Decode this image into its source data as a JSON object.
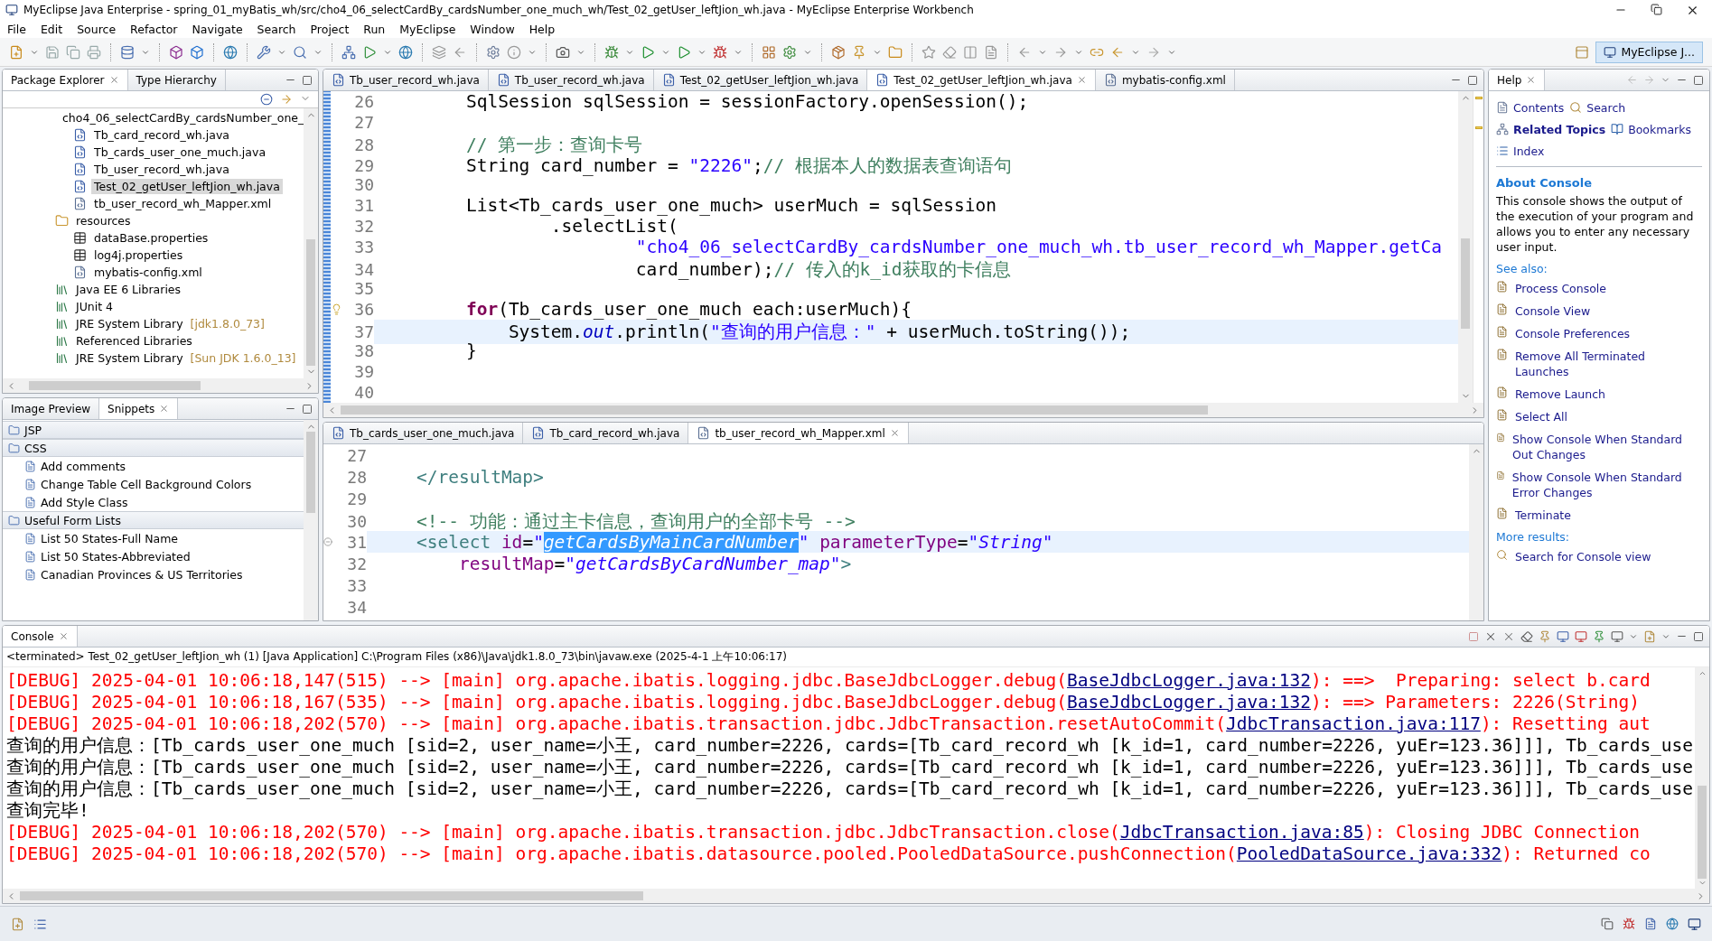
{
  "window": {
    "title": "MyEclipse Java Enterprise - spring_01_myBatis_wh/src/cho4_06_selectCardBy_cardsNumber_one_much_wh/Test_02_getUser_leftJion_wh.java - MyEclipse Enterprise Workbench"
  },
  "menu": [
    "File",
    "Edit",
    "Source",
    "Refactor",
    "Navigate",
    "Search",
    "Project",
    "Run",
    "MyEclipse",
    "Window",
    "Help"
  ],
  "perspective": {
    "label": "MyEclipse J...",
    "selected": true
  },
  "package_explorer": {
    "tabs": [
      {
        "label": "Package Explorer",
        "selected": true
      },
      {
        "label": "Type Hierarchy",
        "selected": false
      }
    ],
    "tree": [
      {
        "label": "cho4_06_selectCardBy_cardsNumber_one_",
        "kind": "package",
        "selected": false,
        "children": [
          {
            "label": "Tb_card_record_wh.java",
            "kind": "java",
            "selected": false
          },
          {
            "label": "Tb_cards_user_one_much.java",
            "kind": "java",
            "selected": false
          },
          {
            "label": "Tb_user_record_wh.java",
            "kind": "java",
            "selected": false
          },
          {
            "label": "Test_02_getUser_leftJion_wh.java",
            "kind": "java",
            "selected": true
          },
          {
            "label": "tb_user_record_wh_Mapper.xml",
            "kind": "xml",
            "selected": false
          }
        ]
      },
      {
        "label": "resources",
        "kind": "folder",
        "selected": false,
        "children": [
          {
            "label": "dataBase.properties",
            "kind": "properties",
            "selected": false
          },
          {
            "label": "log4j.properties",
            "kind": "properties",
            "selected": false
          },
          {
            "label": "mybatis-config.xml",
            "kind": "xml",
            "selected": false
          }
        ]
      },
      {
        "label": "Java EE 6 Libraries",
        "kind": "library",
        "selected": false
      },
      {
        "label": "JUnit 4",
        "kind": "library",
        "selected": false
      },
      {
        "label": "JRE System Library",
        "detail": "[jdk1.8.0_73]",
        "kind": "library",
        "selected": false
      },
      {
        "label": "Referenced Libraries",
        "kind": "library",
        "selected": false
      },
      {
        "label": "JRE System Library",
        "detail": "[Sun JDK 1.6.0_13]",
        "kind": "library",
        "selected": false
      }
    ]
  },
  "snippets": {
    "tabs": [
      {
        "label": "Image Preview",
        "selected": false
      },
      {
        "label": "Snippets",
        "selected": true
      }
    ],
    "drawers": [
      {
        "label": "JSP"
      },
      {
        "label": "CSS",
        "items": [
          "Add comments",
          "Change Table Cell Background Colors",
          "Add Style Class"
        ]
      },
      {
        "label": "Useful Form Lists",
        "items": [
          "List 50 States-Full Name",
          "List 50 States-Abbreviated",
          "Canadian Provinces & US Territories"
        ]
      }
    ]
  },
  "editor": {
    "tabs": [
      {
        "label": "Tb_user_record_wh.java",
        "kind": "java",
        "selected": false
      },
      {
        "label": "Tb_user_record_wh.java",
        "kind": "java",
        "selected": false
      },
      {
        "label": "Test_02_getUser_leftJion_wh.java",
        "kind": "java",
        "selected": false
      },
      {
        "label": "Test_02_getUser_leftJion_wh.java",
        "kind": "java",
        "selected": true
      },
      {
        "label": "mybatis-config.xml",
        "kind": "xml",
        "selected": false
      }
    ],
    "lines": [
      {
        "number": "26",
        "kind": "code",
        "current": false,
        "tokens": [
          {
            "kind": "plain",
            "text": "        SqlSession sqlSession = sessionFactory.openSession();"
          }
        ]
      },
      {
        "number": "27",
        "kind": "code",
        "current": false
      },
      {
        "number": "28",
        "kind": "code",
        "current": false,
        "tokens": [
          {
            "kind": "comment",
            "text": "        // 第一步：查询卡号"
          }
        ]
      },
      {
        "number": "29",
        "kind": "code",
        "current": false,
        "tokens": [
          {
            "kind": "plain",
            "text": "        String card_number = "
          },
          {
            "kind": "string",
            "text": "\"2226\""
          },
          {
            "kind": "plain",
            "text": ";"
          },
          {
            "kind": "comment",
            "text": "// 根据本人的数据表查询语句"
          }
        ]
      },
      {
        "number": "30",
        "kind": "code",
        "current": false
      },
      {
        "number": "31",
        "kind": "code",
        "current": false,
        "tokens": [
          {
            "kind": "plain",
            "text": "        List<Tb_cards_user_one_much> userMuch = sqlSession"
          }
        ]
      },
      {
        "number": "32",
        "kind": "code",
        "current": false,
        "tokens": [
          {
            "kind": "plain",
            "text": "                .selectList("
          }
        ]
      },
      {
        "number": "33",
        "kind": "code",
        "current": false,
        "tokens": [
          {
            "kind": "string",
            "text": "                        \"cho4_06_selectCardBy_cardsNumber_one_much_wh.tb_user_record_wh_Mapper.getCa"
          }
        ]
      },
      {
        "number": "34",
        "kind": "code",
        "current": false,
        "tokens": [
          {
            "kind": "plain",
            "text": "                        card_number);"
          },
          {
            "kind": "comment",
            "text": "// 传入的k_id获取的卡信息"
          }
        ]
      },
      {
        "number": "35",
        "kind": "code",
        "current": false
      },
      {
        "number": "36",
        "kind": "warning",
        "current": false,
        "tokens": [
          {
            "kind": "keyword",
            "text": "        for"
          },
          {
            "kind": "plain",
            "text": "(Tb_cards_user_one_much each:userMuch){"
          }
        ]
      },
      {
        "number": "37",
        "kind": "code",
        "current": true,
        "tokens": [
          {
            "kind": "plain",
            "text": "            System."
          },
          {
            "kind": "field",
            "text": "out"
          },
          {
            "kind": "plain",
            "text": ".println("
          },
          {
            "kind": "string",
            "text": "\"查询的用户信息：\""
          },
          {
            "kind": "plain",
            "text": " + userMuch.toString());"
          }
        ]
      },
      {
        "number": "38",
        "kind": "code",
        "current": false,
        "tokens": [
          {
            "kind": "plain",
            "text": "        }"
          }
        ]
      },
      {
        "number": "39",
        "kind": "code",
        "current": false
      },
      {
        "number": "40",
        "kind": "code",
        "current": false
      }
    ]
  },
  "xml_editor": {
    "tabs": [
      {
        "label": "Tb_cards_user_one_much.java",
        "kind": "java",
        "selected": false
      },
      {
        "label": "Tb_card_record_wh.java",
        "kind": "java",
        "selected": false
      },
      {
        "label": "tb_user_record_wh_Mapper.xml",
        "kind": "xml",
        "selected": true
      }
    ],
    "lines": [
      {
        "number": "27",
        "kind": "code",
        "current": false
      },
      {
        "number": "28",
        "kind": "code",
        "current": false,
        "tokens": [
          {
            "kind": "tag",
            "text": "    </resultMap>"
          }
        ]
      },
      {
        "number": "29",
        "kind": "code",
        "current": false
      },
      {
        "number": "30",
        "kind": "code",
        "current": false,
        "tokens": [
          {
            "kind": "comment",
            "text": "    <!-- 功能：通过主卡信息，查询用户的全部卡号 -->"
          }
        ]
      },
      {
        "number": "31",
        "kind": "fold",
        "current": true,
        "tokens": [
          {
            "kind": "tag",
            "text": "    <select"
          },
          {
            "kind": "attr",
            "text": " id"
          },
          {
            "kind": "plain",
            "text": "="
          },
          {
            "kind": "value",
            "text": "\""
          },
          {
            "kind": "selection",
            "text": "getCardsByMainCardNumber"
          },
          {
            "kind": "value",
            "text": "\""
          },
          {
            "kind": "attr",
            "text": " parameterType"
          },
          {
            "kind": "plain",
            "text": "="
          },
          {
            "kind": "value",
            "text": "\"String\""
          }
        ]
      },
      {
        "number": "32",
        "kind": "code",
        "current": false,
        "tokens": [
          {
            "kind": "attr",
            "text": "        resultMap"
          },
          {
            "kind": "plain",
            "text": "="
          },
          {
            "kind": "value",
            "text": "\"getCardsByCardNumber_map\""
          },
          {
            "kind": "tag",
            "text": ">"
          }
        ]
      },
      {
        "number": "33",
        "kind": "code",
        "current": false
      },
      {
        "number": "34",
        "kind": "code",
        "current": false
      }
    ]
  },
  "help": {
    "tabs": [
      {
        "label": "Help",
        "selected": true
      }
    ],
    "nav_rows": [
      [
        {
          "label": "Contents",
          "kind": "contents",
          "selected": false
        },
        {
          "label": "Search",
          "kind": "search",
          "selected": false
        }
      ],
      [
        {
          "label": "Related Topics",
          "kind": "related",
          "selected": true
        },
        {
          "label": "Bookmarks",
          "kind": "bookmarks",
          "selected": false
        }
      ],
      [
        {
          "label": "Index",
          "kind": "index",
          "selected": false
        }
      ]
    ],
    "heading": "About Console",
    "description": "This console shows the output of the execution of your program and allows you to enter any necessary user input.",
    "see_also_label": "See also:",
    "topics": [
      "Process Console",
      "Console View",
      "Console Preferences",
      "Remove All Terminated Launches",
      "Remove Launch",
      "Select All",
      "Show Console When Standard Out Changes",
      "Show Console When Standard Error Changes",
      "Terminate"
    ],
    "more_results_label": "More results:",
    "search_link": "Search for Console view"
  },
  "console": {
    "tabs": [
      {
        "label": "Console",
        "selected": true
      }
    ],
    "header": "<terminated> Test_02_getUser_leftJion_wh (1) [Java Application] C:\\Program Files (x86)\\Java\\jdk1.8.0_73\\bin\\javaw.exe (2025-4-1 上午10:06:17)",
    "lines": [
      [
        {
          "kind": "debug",
          "text": "[DEBUG] 2025-04-01 10:06:18,147(515) --> [main] org.apache.ibatis.logging.jdbc.BaseJdbcLogger.debug("
        },
        {
          "kind": "link",
          "text": "BaseJdbcLogger.java:132"
        },
        {
          "kind": "debug",
          "text": "): ==>  Preparing: select b.card"
        }
      ],
      [
        {
          "kind": "debug",
          "text": "[DEBUG] 2025-04-01 10:06:18,167(535) --> [main] org.apache.ibatis.logging.jdbc.BaseJdbcLogger.debug("
        },
        {
          "kind": "link",
          "text": "BaseJdbcLogger.java:132"
        },
        {
          "kind": "debug",
          "text": "): ==> Parameters: 2226(String)"
        }
      ],
      [
        {
          "kind": "debug",
          "text": "[DEBUG] 2025-04-01 10:06:18,202(570) --> [main] org.apache.ibatis.transaction.jdbc.JdbcTransaction.resetAutoCommit("
        },
        {
          "kind": "link",
          "text": "JdbcTransaction.java:117"
        },
        {
          "kind": "debug",
          "text": "): Resetting aut"
        }
      ],
      [
        {
          "kind": "plain",
          "text": "查询的用户信息：[Tb_cards_user_one_much [sid=2, user_name=小王, card_number=2226, cards=[Tb_card_record_wh [k_id=1, card_number=2226, yuEr=123.36]]], Tb_cards_use"
        }
      ],
      [
        {
          "kind": "plain",
          "text": "查询的用户信息：[Tb_cards_user_one_much [sid=2, user_name=小王, card_number=2226, cards=[Tb_card_record_wh [k_id=1, card_number=2226, yuEr=123.36]]], Tb_cards_use"
        }
      ],
      [
        {
          "kind": "plain",
          "text": "查询的用户信息：[Tb_cards_user_one_much [sid=2, user_name=小王, card_number=2226, cards=[Tb_card_record_wh [k_id=1, card_number=2226, yuEr=123.36]]], Tb_cards_use"
        }
      ],
      [
        {
          "kind": "plain",
          "text": "查询完毕!"
        }
      ],
      [
        {
          "kind": "debug",
          "text": "[DEBUG] 2025-04-01 10:06:18,202(570) --> [main] org.apache.ibatis.transaction.jdbc.JdbcTransaction.close("
        },
        {
          "kind": "link",
          "text": "JdbcTransaction.java:85"
        },
        {
          "kind": "debug",
          "text": "): Closing JDBC Connection"
        }
      ],
      [
        {
          "kind": "debug",
          "text": "[DEBUG] 2025-04-01 10:06:18,202(570) --> [main] org.apache.ibatis.datasource.pooled.PooledDataSource.pushConnection("
        },
        {
          "kind": "link",
          "text": "PooledDataSource.java:332"
        },
        {
          "kind": "debug",
          "text": "): Returned co"
        }
      ]
    ]
  }
}
